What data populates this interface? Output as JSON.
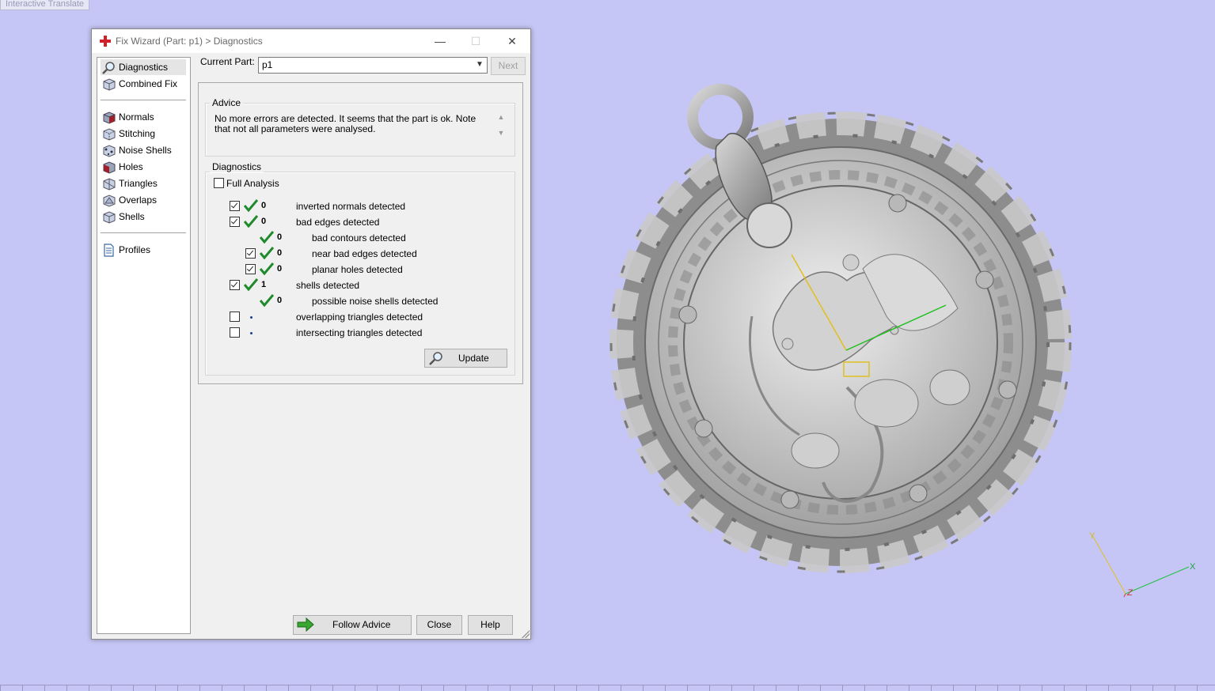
{
  "viewport": {
    "mode_label": "Interactive Translate",
    "background_color": "#c6c6f6"
  },
  "dialog": {
    "title": "Fix Wizard (Part: p1) > Diagnostics",
    "controls": {
      "minimize": "—",
      "maximize": "☐",
      "close": "✕"
    }
  },
  "sidebar": {
    "items": [
      {
        "label": "Diagnostics",
        "icon": "magnifier-icon",
        "selected": true
      },
      {
        "label": "Combined Fix",
        "icon": "cube-gear-icon"
      },
      {
        "label": "Normals",
        "icon": "normals-cube-icon"
      },
      {
        "label": "Stitching",
        "icon": "stitching-cube-icon"
      },
      {
        "label": "Noise Shells",
        "icon": "noise-shells-icon"
      },
      {
        "label": "Holes",
        "icon": "holes-cube-icon"
      },
      {
        "label": "Triangles",
        "icon": "triangles-cube-icon"
      },
      {
        "label": "Overlaps",
        "icon": "overlaps-cube-icon"
      },
      {
        "label": "Shells",
        "icon": "shells-cube-icon"
      },
      {
        "label": "Profiles",
        "icon": "document-icon"
      }
    ]
  },
  "current_part": {
    "label": "Current Part:",
    "value": "p1",
    "next_label": "Next"
  },
  "advice": {
    "legend": "Advice",
    "text": "No more errors are detected. It seems that the part is ok. Note that not all parameters were analysed."
  },
  "diagnostics": {
    "legend": "Diagnostics",
    "full_analysis_label": "Full Analysis",
    "rows": [
      {
        "checkbox": true,
        "checked": true,
        "status": "ok",
        "count": "0",
        "label": "inverted normals detected"
      },
      {
        "checkbox": true,
        "checked": true,
        "status": "ok",
        "count": "0",
        "label": "bad edges detected"
      },
      {
        "checkbox": false,
        "checked": false,
        "status": "ok",
        "count": "0",
        "label": "bad contours detected"
      },
      {
        "checkbox": true,
        "checked": true,
        "status": "ok",
        "count": "0",
        "label": "near bad edges detected"
      },
      {
        "checkbox": true,
        "checked": true,
        "status": "ok",
        "count": "0",
        "label": "planar holes detected"
      },
      {
        "checkbox": true,
        "checked": true,
        "status": "ok",
        "count": "1",
        "label": "shells detected"
      },
      {
        "checkbox": false,
        "checked": false,
        "status": "ok",
        "count": "0",
        "label": "possible noise shells detected"
      },
      {
        "checkbox": true,
        "checked": false,
        "status": "pending",
        "count": "",
        "label": "overlapping triangles detected"
      },
      {
        "checkbox": true,
        "checked": false,
        "status": "pending",
        "count": "",
        "label": "intersecting triangles detected"
      }
    ],
    "update_label": "Update"
  },
  "buttons": {
    "follow_advice": "Follow Advice",
    "close": "Close",
    "help": "Help"
  },
  "axes": {
    "x": "X",
    "y": "Y",
    "z": "Z"
  },
  "colors": {
    "ok_check": "#1f8a2c",
    "accent_red": "#d0202a",
    "follow_arrow": "#3aa830"
  }
}
